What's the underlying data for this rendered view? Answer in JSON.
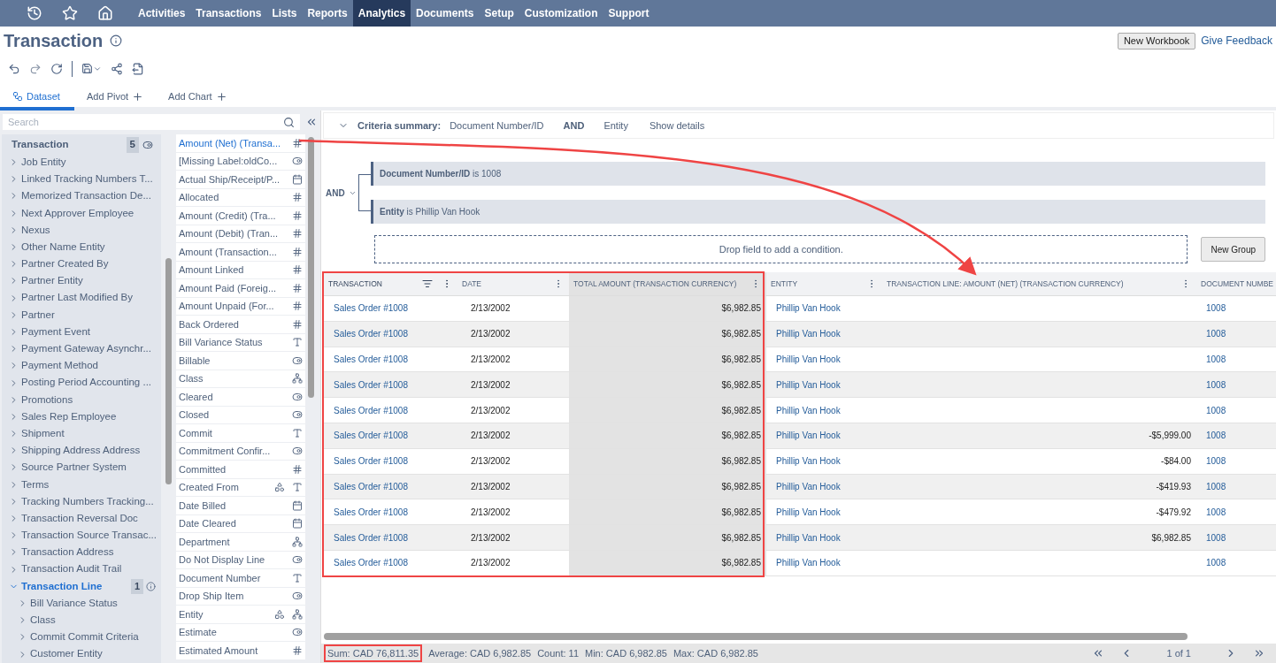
{
  "nav": {
    "items": [
      {
        "label": "Activities",
        "selected": false
      },
      {
        "label": "Transactions",
        "selected": false
      },
      {
        "label": "Lists",
        "selected": false
      },
      {
        "label": "Reports",
        "selected": false
      },
      {
        "label": "Analytics",
        "selected": true
      },
      {
        "label": "Documents",
        "selected": false
      },
      {
        "label": "Setup",
        "selected": false
      },
      {
        "label": "Customization",
        "selected": false
      },
      {
        "label": "Support",
        "selected": false
      }
    ]
  },
  "page": {
    "title": "Transaction",
    "buttons": [
      "New Workbook"
    ],
    "link": "Give Feedback"
  },
  "tabs": [
    {
      "label": "Dataset",
      "selected": true,
      "kind": "dataset"
    },
    {
      "label": "Add Pivot",
      "selected": false,
      "kind": "add"
    },
    {
      "label": "Add Chart",
      "selected": false,
      "kind": "add"
    }
  ],
  "search": {
    "placeholder": "Search"
  },
  "tree": {
    "label": "Transaction",
    "badge": "5",
    "children": [
      {
        "label": "Job Entity",
        "expanded": false
      },
      {
        "label": "Linked Tracking Numbers T...",
        "expanded": false
      },
      {
        "label": "Memorized Transaction De...",
        "expanded": false
      },
      {
        "label": "Next Approver Employee",
        "expanded": false
      },
      {
        "label": "Nexus",
        "expanded": false
      },
      {
        "label": "Other Name Entity",
        "expanded": false
      },
      {
        "label": "Partner Created By",
        "expanded": false
      },
      {
        "label": "Partner Entity",
        "expanded": false
      },
      {
        "label": "Partner Last Modified By",
        "expanded": false
      },
      {
        "label": "Partner",
        "expanded": false
      },
      {
        "label": "Payment Event",
        "expanded": false
      },
      {
        "label": "Payment Gateway Asynchr...",
        "expanded": false
      },
      {
        "label": "Payment Method",
        "expanded": false
      },
      {
        "label": "Posting Period Accounting ...",
        "expanded": false
      },
      {
        "label": "Promotions",
        "expanded": false
      },
      {
        "label": "Sales Rep Employee",
        "expanded": false
      },
      {
        "label": "Shipment",
        "expanded": false
      },
      {
        "label": "Shipping Address Address",
        "expanded": false
      },
      {
        "label": "Source Partner System",
        "expanded": false
      },
      {
        "label": "Terms",
        "expanded": false
      },
      {
        "label": "Tracking Numbers Tracking...",
        "expanded": false
      },
      {
        "label": "Transaction Reversal Doc",
        "expanded": false
      },
      {
        "label": "Transaction Source Transac...",
        "expanded": false
      },
      {
        "label": "Transaction Address",
        "expanded": false
      },
      {
        "label": "Transaction Audit Trail",
        "expanded": false
      },
      {
        "label": "Transaction Line",
        "expanded": true,
        "badge": "1",
        "children": [
          {
            "label": "Bill Variance Status",
            "expanded": false
          },
          {
            "label": "Class",
            "expanded": false
          },
          {
            "label": "Commit Commit Criteria",
            "expanded": false
          },
          {
            "label": "Customer Entity",
            "expanded": false
          }
        ]
      }
    ]
  },
  "fields": [
    {
      "label": "Amount (Net) (Transa...",
      "selected": true,
      "icons": [
        {
          "kind": "number"
        }
      ]
    },
    {
      "label": "[Missing Label:oldCo...",
      "selected": false,
      "icons": [
        {
          "kind": "toggle"
        }
      ]
    },
    {
      "label": "Actual Ship/Receipt/P...",
      "selected": false,
      "icons": [
        {
          "kind": "date"
        }
      ]
    },
    {
      "label": "Allocated",
      "selected": false,
      "icons": [
        {
          "kind": "number"
        }
      ]
    },
    {
      "label": "Amount (Credit) (Tra...",
      "selected": false,
      "icons": [
        {
          "kind": "number"
        }
      ]
    },
    {
      "label": "Amount (Debit) (Tran...",
      "selected": false,
      "icons": [
        {
          "kind": "number"
        }
      ]
    },
    {
      "label": "Amount (Transaction...",
      "selected": false,
      "icons": [
        {
          "kind": "number"
        }
      ]
    },
    {
      "label": "Amount Linked",
      "selected": false,
      "icons": [
        {
          "kind": "number"
        }
      ]
    },
    {
      "label": "Amount Paid (Foreig...",
      "selected": false,
      "icons": [
        {
          "kind": "number"
        }
      ]
    },
    {
      "label": "Amount Unpaid (For...",
      "selected": false,
      "icons": [
        {
          "kind": "number"
        }
      ]
    },
    {
      "label": "Back Ordered",
      "selected": false,
      "icons": [
        {
          "kind": "number"
        }
      ]
    },
    {
      "label": "Bill Variance Status",
      "selected": false,
      "icons": [
        {
          "kind": "text"
        }
      ]
    },
    {
      "label": "Billable",
      "selected": false,
      "icons": [
        {
          "kind": "toggle"
        }
      ]
    },
    {
      "label": "Class",
      "selected": false,
      "icons": [
        {
          "kind": "hierarchy"
        }
      ]
    },
    {
      "label": "Cleared",
      "selected": false,
      "icons": [
        {
          "kind": "toggle"
        }
      ]
    },
    {
      "label": "Closed",
      "selected": false,
      "icons": [
        {
          "kind": "toggle"
        }
      ]
    },
    {
      "label": "Commit",
      "selected": false,
      "icons": [
        {
          "kind": "text"
        }
      ]
    },
    {
      "label": "Commitment Confir...",
      "selected": false,
      "icons": [
        {
          "kind": "toggle"
        }
      ]
    },
    {
      "label": "Committed",
      "selected": false,
      "icons": [
        {
          "kind": "number"
        }
      ]
    },
    {
      "label": "Created From",
      "selected": false,
      "icons": [
        {
          "kind": "mixed"
        },
        {
          "kind": "text"
        }
      ]
    },
    {
      "label": "Date Billed",
      "selected": false,
      "icons": [
        {
          "kind": "date"
        }
      ]
    },
    {
      "label": "Date Cleared",
      "selected": false,
      "icons": [
        {
          "kind": "date"
        }
      ]
    },
    {
      "label": "Department",
      "selected": false,
      "icons": [
        {
          "kind": "hierarchy"
        }
      ]
    },
    {
      "label": "Do Not Display Line",
      "selected": false,
      "icons": [
        {
          "kind": "toggle"
        }
      ]
    },
    {
      "label": "Document Number",
      "selected": false,
      "icons": [
        {
          "kind": "text"
        }
      ]
    },
    {
      "label": "Drop Ship Item",
      "selected": false,
      "icons": [
        {
          "kind": "toggle"
        }
      ]
    },
    {
      "label": "Entity",
      "selected": false,
      "icons": [
        {
          "kind": "mixed"
        },
        {
          "kind": "hierarchy"
        }
      ]
    },
    {
      "label": "Estimate",
      "selected": false,
      "icons": [
        {
          "kind": "toggle"
        }
      ]
    },
    {
      "label": "Estimated Amount",
      "selected": false,
      "icons": [
        {
          "kind": "number"
        }
      ]
    }
  ],
  "criteria_summary": {
    "label": "Criteria summary:",
    "parts": [
      "Document Number/ID",
      "AND",
      "Entity"
    ],
    "link": "Show details"
  },
  "conditions": {
    "operator": "AND",
    "items": [
      {
        "field": "Document Number/ID",
        "op": "is",
        "value": "1008"
      },
      {
        "field": "Entity",
        "op": "is",
        "value": "Phillip Van Hook"
      }
    ],
    "drop_hint": "Drop field to add a condition.",
    "button": "New Group"
  },
  "table": {
    "columns": [
      {
        "label": "TRANSACTION",
        "sorted": true,
        "highlighted": false
      },
      {
        "label": "DATE",
        "sorted": false,
        "highlighted": false
      },
      {
        "label": "TOTAL AMOUNT (TRANSACTION CURRENCY)",
        "sorted": false,
        "highlighted": true
      },
      {
        "label": "ENTITY",
        "sorted": false,
        "highlighted": false
      },
      {
        "label": "TRANSACTION LINE: AMOUNT (NET) (TRANSACTION CURRENCY)",
        "sorted": false,
        "highlighted": false
      },
      {
        "label": "DOCUMENT NUMBE",
        "sorted": false,
        "highlighted": false
      }
    ],
    "rows": [
      [
        "Sales Order #1008",
        "2/13/2002",
        "$6,982.85",
        "Phillip Van Hook",
        "",
        "1008"
      ],
      [
        "Sales Order #1008",
        "2/13/2002",
        "$6,982.85",
        "Phillip Van Hook",
        "",
        "1008"
      ],
      [
        "Sales Order #1008",
        "2/13/2002",
        "$6,982.85",
        "Phillip Van Hook",
        "",
        "1008"
      ],
      [
        "Sales Order #1008",
        "2/13/2002",
        "$6,982.85",
        "Phillip Van Hook",
        "",
        "1008"
      ],
      [
        "Sales Order #1008",
        "2/13/2002",
        "$6,982.85",
        "Phillip Van Hook",
        "",
        "1008"
      ],
      [
        "Sales Order #1008",
        "2/13/2002",
        "$6,982.85",
        "Phillip Van Hook",
        "-$5,999.00",
        "1008"
      ],
      [
        "Sales Order #1008",
        "2/13/2002",
        "$6,982.85",
        "Phillip Van Hook",
        "-$84.00",
        "1008"
      ],
      [
        "Sales Order #1008",
        "2/13/2002",
        "$6,982.85",
        "Phillip Van Hook",
        "-$419.93",
        "1008"
      ],
      [
        "Sales Order #1008",
        "2/13/2002",
        "$6,982.85",
        "Phillip Van Hook",
        "-$479.92",
        "1008"
      ],
      [
        "Sales Order #1008",
        "2/13/2002",
        "$6,982.85",
        "Phillip Van Hook",
        "$6,982.85",
        "1008"
      ],
      [
        "Sales Order #1008",
        "2/13/2002",
        "$6,982.85",
        "Phillip Van Hook",
        "",
        "1008"
      ]
    ]
  },
  "summary": {
    "items": [
      {
        "text": "Sum: CAD 76,811.35",
        "highlighted": true
      },
      {
        "text": "Average: CAD 6,982.85",
        "highlighted": false
      },
      {
        "text": "Count: 11",
        "highlighted": false
      },
      {
        "text": "Min: CAD 6,982.85",
        "highlighted": false
      },
      {
        "text": "Max: CAD 6,982.85",
        "highlighted": false
      }
    ],
    "pager": "1 of 1"
  }
}
